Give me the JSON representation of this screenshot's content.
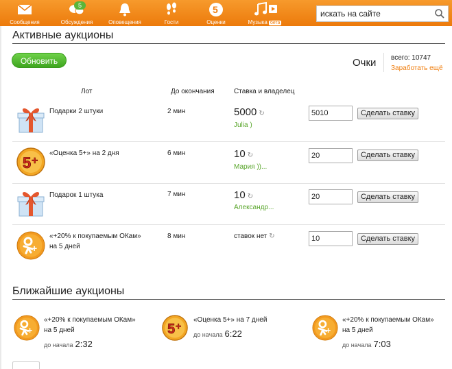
{
  "nav": {
    "items": [
      {
        "label": "Сообщения",
        "icon": "envelope-icon"
      },
      {
        "label": "Обсуждения",
        "icon": "chat-bubbles-icon",
        "badge": "5"
      },
      {
        "label": "Оповещения",
        "icon": "bell-icon"
      },
      {
        "label": "Гости",
        "icon": "footprints-icon"
      },
      {
        "label": "Оценки",
        "icon": "rating-five-icon",
        "icon_text": "5"
      },
      {
        "label": "Музыка",
        "icon": "music-note-icon",
        "beta": "бета"
      }
    ]
  },
  "search": {
    "placeholder": "искать на сайте",
    "icon": "search-icon"
  },
  "active": {
    "title": "Активные аукционы",
    "refresh_label": "Обновить",
    "points_label": "Очки",
    "total": "всего: 10747",
    "earn_link": "Заработать ещё",
    "columns": {
      "lot": "Лот",
      "until_end": "До окончания",
      "bid_owner": "Ставка и владелец"
    },
    "rows": [
      {
        "icon": "gift-box-icon",
        "name": "Подарки 2 штуки",
        "time": "2 мин",
        "bid": "5000",
        "owner": "Julia )",
        "input": "5010",
        "button": "Сделать ставку"
      },
      {
        "icon": "five-plus-medal-icon",
        "name": "«Оценка 5+» на 2 дня",
        "time": "6 мин",
        "bid": "10",
        "owner": "Мария ))...",
        "input": "20",
        "button": "Сделать ставку"
      },
      {
        "icon": "gift-box-icon",
        "name": "Подарок 1 штука",
        "time": "7 мин",
        "bid": "10",
        "owner": "Александр...",
        "input": "20",
        "button": "Сделать ставку"
      },
      {
        "icon": "ok-coin-icon",
        "name_line1": "«+20% к покупаемым ОКам»",
        "name_line2": "на 5 дней",
        "time": "8 мин",
        "no_bid": "ставок нет",
        "input": "10",
        "button": "Сделать ставку"
      }
    ]
  },
  "upcoming": {
    "title": "Ближайшие аукционы",
    "start_label": "до начала",
    "items": [
      {
        "icon": "ok-coin-icon",
        "name_line1": "«+20% к покупаемым ОКам»",
        "name_line2": "на 5 дней",
        "time": "2:32"
      },
      {
        "icon": "five-plus-medal-icon",
        "name_line1": "«Оценка 5+» на 7 дней",
        "name_line2": "",
        "time": "6:22"
      },
      {
        "icon": "ok-coin-icon",
        "name_line1": "«+20% к покупаемым ОКам»",
        "name_line2": "на 5 дней",
        "time": "7:03"
      }
    ]
  },
  "colors": {
    "brand": "#f07f10",
    "green": "#5aa62c",
    "button_green": "#4cb82a"
  }
}
